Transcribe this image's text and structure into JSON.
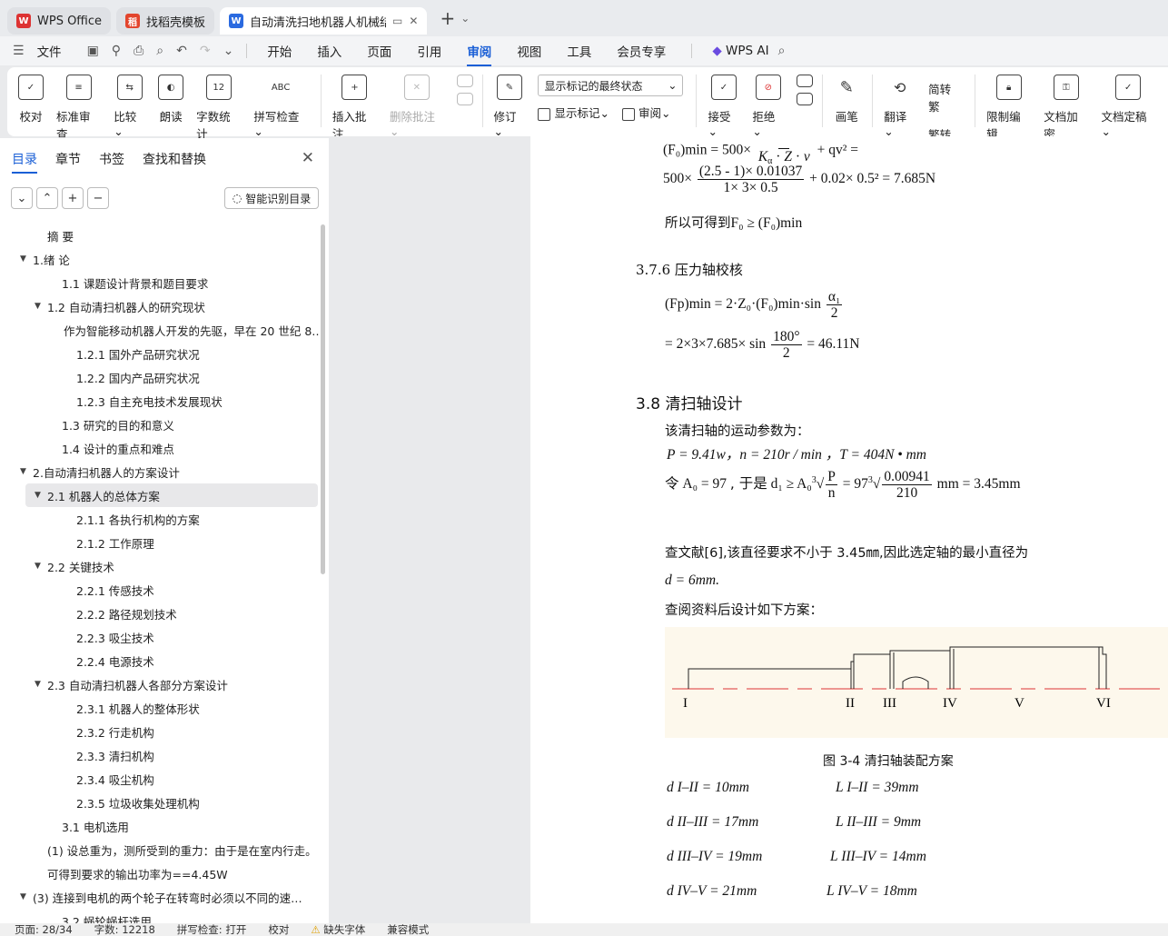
{
  "tabs": [
    {
      "label": "WPS Office",
      "logo": "W"
    },
    {
      "label": "找稻壳模板",
      "logo": "稻"
    },
    {
      "label": "自动清洗扫地机器人机械结构",
      "logo": "W"
    }
  ],
  "menu": {
    "file": "文件",
    "items": [
      "开始",
      "插入",
      "页面",
      "引用",
      "审阅",
      "视图",
      "工具",
      "会员专享"
    ],
    "active": "审阅",
    "ai": "WPS AI"
  },
  "ribbon": {
    "proof": "校对",
    "std_review": "标准审查",
    "compare": "比较",
    "read_aloud": "朗读",
    "word_count": "字数统计",
    "spell_check": "拼写检查",
    "insert_comment": "插入批注",
    "delete_comment": "删除批注",
    "track": "修订",
    "display_state": "显示标记的最终状态",
    "show_marks": "显示标记",
    "review": "审阅",
    "accept": "接受",
    "reject": "拒绝",
    "ink": "画笔",
    "translate": "翻译",
    "to_trad": "简转繁",
    "to_simp": "繁转简",
    "restrict": "限制编辑",
    "encrypt": "文档加密",
    "finalize": "文档定稿"
  },
  "sidebar": {
    "tabs": [
      "目录",
      "章节",
      "书签",
      "查找和替换"
    ],
    "smart_btn": "智能识别目录",
    "toc": [
      {
        "text": "摘    要",
        "level": 1,
        "arrow": ""
      },
      {
        "text": "1.绪  论",
        "level": 0,
        "arrow": "▼"
      },
      {
        "text": "1.1   课题设计背景和题目要求",
        "level": 2,
        "arrow": ""
      },
      {
        "text": "1.2   自动清扫机器人的研究现状",
        "level": 1,
        "arrow": "▼"
      },
      {
        "text": "作为智能移动机器人开发的先驱，早在 20 世纪 8…",
        "level": 3,
        "arrow": ""
      },
      {
        "text": "1.2.1   国外产品研究状况",
        "level": 3,
        "arrow": ""
      },
      {
        "text": "1.2.2   国内产品研究状况",
        "level": 3,
        "arrow": ""
      },
      {
        "text": "1.2.3   自主充电技术发展现状",
        "level": 3,
        "arrow": ""
      },
      {
        "text": "1.3   研究的目的和意义",
        "level": 2,
        "arrow": ""
      },
      {
        "text": "1.4   设计的重点和难点",
        "level": 2,
        "arrow": ""
      },
      {
        "text": "2.自动清扫机器人的方案设计",
        "level": 0,
        "arrow": "▼"
      },
      {
        "text": "2.1   机器人的总体方案",
        "level": 1,
        "arrow": "▼",
        "selected": true
      },
      {
        "text": "2.1.1   各执行机构的方案",
        "level": 3,
        "arrow": ""
      },
      {
        "text": "2.1.2   工作原理",
        "level": 3,
        "arrow": ""
      },
      {
        "text": "2.2   关键技术",
        "level": 1,
        "arrow": "▼"
      },
      {
        "text": "2.2.1   传感技术",
        "level": 3,
        "arrow": ""
      },
      {
        "text": "2.2.2   路径规划技术",
        "level": 3,
        "arrow": ""
      },
      {
        "text": "2.2.3   吸尘技术",
        "level": 3,
        "arrow": ""
      },
      {
        "text": "2.2.4   电源技术",
        "level": 3,
        "arrow": ""
      },
      {
        "text": "2.3   自动清扫机器人各部分方案设计",
        "level": 1,
        "arrow": "▼"
      },
      {
        "text": "2.3.1   机器人的整体形状",
        "level": 3,
        "arrow": ""
      },
      {
        "text": "2.3.2   行走机构",
        "level": 3,
        "arrow": ""
      },
      {
        "text": "2.3.3   清扫机构",
        "level": 3,
        "arrow": ""
      },
      {
        "text": "2.3.4   吸尘机构",
        "level": 3,
        "arrow": ""
      },
      {
        "text": "2.3.5   垃圾收集处理机构",
        "level": 3,
        "arrow": ""
      },
      {
        "text": "3.1   电机选用",
        "level": 2,
        "arrow": ""
      },
      {
        "text": "(1)  设总重为，测所受到的重力：由于是在室内行走。",
        "level": 4,
        "arrow": ""
      },
      {
        "text": "可得到要求的输出功率为==4.45W",
        "level": 4,
        "arrow": ""
      },
      {
        "text": "(3)  连接到电机的两个轮子在转弯时必须以不同的速…",
        "level": 0,
        "arrow": "▼"
      },
      {
        "text": "3.2   蜗轮蜗杆选用",
        "level": 2,
        "arrow": ""
      }
    ]
  },
  "doc": {
    "eq_top": "(F₀)min = 500×",
    "eq_top_tail": "+ qv² =",
    "eq2_left": "500×",
    "eq2_num": "(2.5 - 1)× 0.01037",
    "eq2_den": "1× 3× 0.5",
    "eq2_right": "+ 0.02× 0.5² = 7.685N",
    "so_text": "所以可得到",
    "so_formula": "F₀ ≥ (F₀)min",
    "sec376": "3.7.6   压力轴校核",
    "eq3": "(Fp)min = 2·Z₀·(F₀)min·sin",
    "eq3_num": "α₁",
    "eq3_den": "2",
    "eq4_left": "= 2×3×7.685× sin",
    "eq4_num": "180°",
    "eq4_den": "2",
    "eq4_right": "= 46.11N",
    "sec38": "3.8  清扫轴设计",
    "param_intro": "该清扫轴的运动参数为：",
    "params": "P = 9.41w，n = 210r / min ，T = 404N • mm",
    "ling": "令",
    "a0": "A₀ = 97",
    "yushi": ", 于是",
    "d1": "d₁ ≥ A₀",
    "root_P": "P",
    "root_n": "n",
    "eq5_mid": "= 97",
    "root_num": "0.00941",
    "root_den": "210",
    "eq5_tail": "mm = 3.45mm",
    "lit": "查文献[6],该直径要求不小于 3.45㎜,因此选定轴的最小直径为",
    "d6": "d = 6mm.",
    "scheme": "查阅资料后设计如下方案：",
    "fig_labels": [
      "I",
      "II",
      "III",
      "IV",
      "V",
      "VI"
    ],
    "caption": "图 3-4   清扫轴装配方案",
    "dims": [
      {
        "d": "d I–II = 10mm",
        "L": "L I–II = 39mm"
      },
      {
        "d": "d II–III = 17mm",
        "L": "L II–III = 9mm"
      },
      {
        "d": "d III–IV = 19mm",
        "L": "L III–IV = 14mm"
      },
      {
        "d": "d IV–V = 21mm",
        "L": "L IV–V = 18mm"
      }
    ]
  },
  "status": {
    "page": "页面: 28/34",
    "words": "字数: 12218",
    "spell": "拼写检查: 打开",
    "proof": "校对",
    "font": "缺失字体",
    "compat": "兼容模式"
  }
}
